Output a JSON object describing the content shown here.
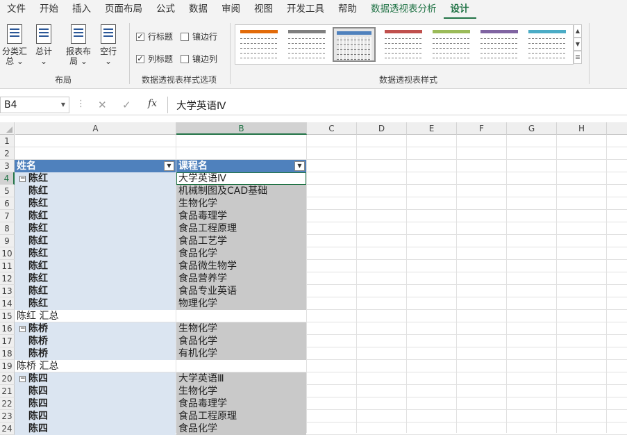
{
  "menu": {
    "tabs": [
      "文件",
      "开始",
      "插入",
      "页面布局",
      "公式",
      "数据",
      "审阅",
      "视图",
      "开发工具",
      "帮助",
      "数据透视表分析",
      "设计"
    ]
  },
  "ribbon": {
    "layout_group": {
      "label": "布局",
      "buttons": [
        {
          "line1": "分类汇",
          "line2": "总 ⌄"
        },
        {
          "line1": "总计",
          "line2": "⌄"
        },
        {
          "line1": "报表布",
          "line2": "局 ⌄"
        },
        {
          "line1": "空行",
          "line2": "⌄"
        }
      ]
    },
    "options_group": {
      "label": "数据透视表样式选项",
      "row_headers": "行标题",
      "banded_rows": "镶边行",
      "col_headers": "列标题",
      "banded_cols": "镶边列"
    },
    "styles_group": {
      "label": "数据透视表样式",
      "swatch_colors": [
        "#e26b0a",
        "#7f7f7f",
        "#4f81bd",
        "#c0504d",
        "#9bbb59",
        "#8064a2",
        "#4bacc6"
      ]
    }
  },
  "formula_bar": {
    "name_box": "B4",
    "content": "大学英语Ⅳ"
  },
  "columns": [
    "A",
    "B",
    "C",
    "D",
    "E",
    "F",
    "G",
    "H"
  ],
  "rows": [
    "1",
    "2",
    "3",
    "4",
    "5",
    "6",
    "7",
    "8",
    "9",
    "10",
    "11",
    "12",
    "13",
    "14",
    "15",
    "16",
    "17",
    "18",
    "19",
    "20",
    "21",
    "22",
    "23",
    "24"
  ],
  "pivot": {
    "header_a": "姓名",
    "header_b": "课程名",
    "cells": [
      {
        "a": "陈红",
        "b": "大学英语Ⅳ",
        "toggle": true
      },
      {
        "a": "陈红",
        "b": "机械制图及CAD基础"
      },
      {
        "a": "陈红",
        "b": "生物化学"
      },
      {
        "a": "陈红",
        "b": "食品毒理学"
      },
      {
        "a": "陈红",
        "b": "食品工程原理"
      },
      {
        "a": "陈红",
        "b": "食品工艺学"
      },
      {
        "a": "陈红",
        "b": "食品化学"
      },
      {
        "a": "陈红",
        "b": "食品微生物学"
      },
      {
        "a": "陈红",
        "b": "食品营养学"
      },
      {
        "a": "陈红",
        "b": "食品专业英语"
      },
      {
        "a": "陈红",
        "b": "物理化学"
      },
      {
        "subtotal": "陈红 汇总"
      },
      {
        "a": "陈桥",
        "b": "生物化学",
        "toggle": true
      },
      {
        "a": "陈桥",
        "b": "食品化学"
      },
      {
        "a": "陈桥",
        "b": "有机化学"
      },
      {
        "subtotal": "陈桥 汇总"
      },
      {
        "a": "陈四",
        "b": "大学英语Ⅲ",
        "toggle": true
      },
      {
        "a": "陈四",
        "b": "生物化学"
      },
      {
        "a": "陈四",
        "b": "食品毒理学"
      },
      {
        "a": "陈四",
        "b": "食品工程原理"
      },
      {
        "a": "陈四",
        "b": "食品化学"
      }
    ]
  }
}
